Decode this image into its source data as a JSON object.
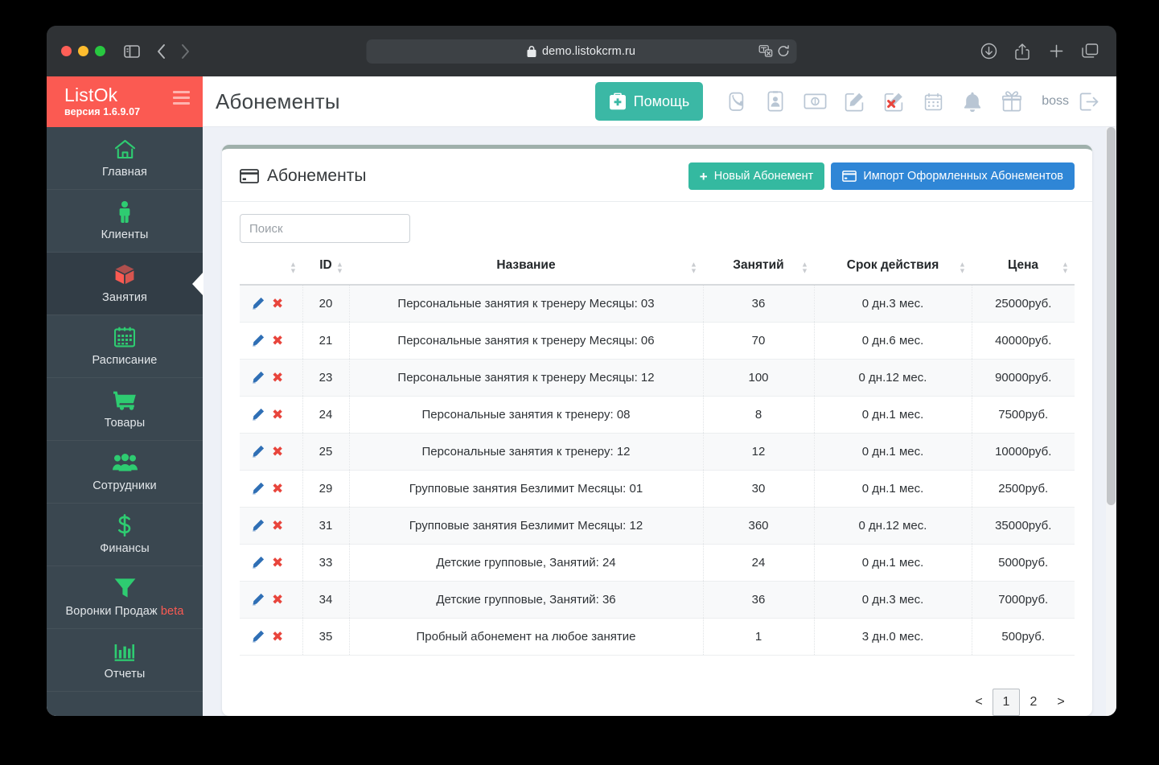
{
  "browser": {
    "url": "demo.listokcrm.ru",
    "lock_icon": "lock-icon",
    "shield_icon": "shield-icon",
    "back_icon": "chevron-left-icon",
    "forward_icon": "chevron-right-icon",
    "sidebar_toggle_icon": "sidebar-toggle-icon",
    "translate_icon": "translate-icon",
    "reload_icon": "reload-icon",
    "download_icon": "download-icon",
    "share_icon": "share-icon",
    "newtab_icon": "plus-icon",
    "tabs_icon": "tabs-icon"
  },
  "sidebar": {
    "brand": "ListOk",
    "version": "версия 1.6.9.07",
    "menu_icon": "hamburger-icon",
    "items": [
      {
        "label": "Главная",
        "icon": "home-icon",
        "active": false,
        "beta": ""
      },
      {
        "label": "Клиенты",
        "icon": "person-icon",
        "active": false,
        "beta": ""
      },
      {
        "label": "Занятия",
        "icon": "box-icon",
        "active": true,
        "beta": ""
      },
      {
        "label": "Расписание",
        "icon": "calendar-icon",
        "active": false,
        "beta": ""
      },
      {
        "label": "Товары",
        "icon": "cart-icon",
        "active": false,
        "beta": ""
      },
      {
        "label": "Сотрудники",
        "icon": "people-icon",
        "active": false,
        "beta": ""
      },
      {
        "label": "Финансы",
        "icon": "dollar-icon",
        "active": false,
        "beta": ""
      },
      {
        "label": "Воронки Продаж",
        "icon": "funnel-icon",
        "active": false,
        "beta": "beta"
      },
      {
        "label": "Отчеты",
        "icon": "bar-chart-icon",
        "active": false,
        "beta": ""
      }
    ]
  },
  "topbar": {
    "title": "Абонементы",
    "help_label": "Помощь",
    "help_icon": "first-aid-icon",
    "user": "boss",
    "icons": [
      "phone-icon",
      "contact-card-icon",
      "money-icon",
      "edit-icon",
      "edit-cancel-icon",
      "calendar-small-icon",
      "bell-icon",
      "gift-icon"
    ],
    "logout_icon": "logout-icon"
  },
  "card": {
    "title": "Абонементы",
    "title_icon": "card-icon",
    "new_button": "Новый Абонемент",
    "new_button_icon": "plus-icon",
    "import_button": "Импорт Оформленных Абонементов",
    "import_button_icon": "import-icon",
    "search_placeholder": "Поиск",
    "search_value": ""
  },
  "table": {
    "columns": [
      "",
      "ID",
      "Название",
      "Занятий",
      "Срок действия",
      "Цена"
    ],
    "rows": [
      {
        "id": "20",
        "name": "Персональные занятия к тренеру Месяцы: 03",
        "lessons": "36",
        "term": "0 дн.3 мес.",
        "price": "25000руб."
      },
      {
        "id": "21",
        "name": "Персональные занятия к тренеру Месяцы: 06",
        "lessons": "70",
        "term": "0 дн.6 мес.",
        "price": "40000руб."
      },
      {
        "id": "23",
        "name": "Персональные занятия к тренеру Месяцы: 12",
        "lessons": "100",
        "term": "0 дн.12 мес.",
        "price": "90000руб."
      },
      {
        "id": "24",
        "name": "Персональные занятия к тренеру: 08",
        "lessons": "8",
        "term": "0 дн.1 мес.",
        "price": "7500руб."
      },
      {
        "id": "25",
        "name": "Персональные занятия к тренеру: 12",
        "lessons": "12",
        "term": "0 дн.1 мес.",
        "price": "10000руб."
      },
      {
        "id": "29",
        "name": "Групповые занятия Безлимит Месяцы: 01",
        "lessons": "30",
        "term": "0 дн.1 мес.",
        "price": "2500руб."
      },
      {
        "id": "31",
        "name": "Групповые занятия Безлимит Месяцы: 12",
        "lessons": "360",
        "term": "0 дн.12 мес.",
        "price": "35000руб."
      },
      {
        "id": "33",
        "name": "Детские групповые, Занятий: 24",
        "lessons": "24",
        "term": "0 дн.1 мес.",
        "price": "5000руб."
      },
      {
        "id": "34",
        "name": "Детские групповые, Занятий: 36",
        "lessons": "36",
        "term": "0 дн.3 мес.",
        "price": "7000руб."
      },
      {
        "id": "35",
        "name": "Пробный абонемент на любое занятие",
        "lessons": "1",
        "term": "3 дн.0 мес.",
        "price": "500руб."
      }
    ],
    "row_edit_icon": "pencil-icon",
    "row_delete_icon": "delete-x-icon"
  },
  "pagination": {
    "prev": "<",
    "next": ">",
    "pages": [
      "1",
      "2"
    ],
    "current": "1"
  },
  "colors": {
    "brand_red": "#fb5a52",
    "sidebar": "#3a4750",
    "accent_green": "#2ecc71",
    "teal": "#3bb8a5",
    "blue": "#2f86d6"
  }
}
